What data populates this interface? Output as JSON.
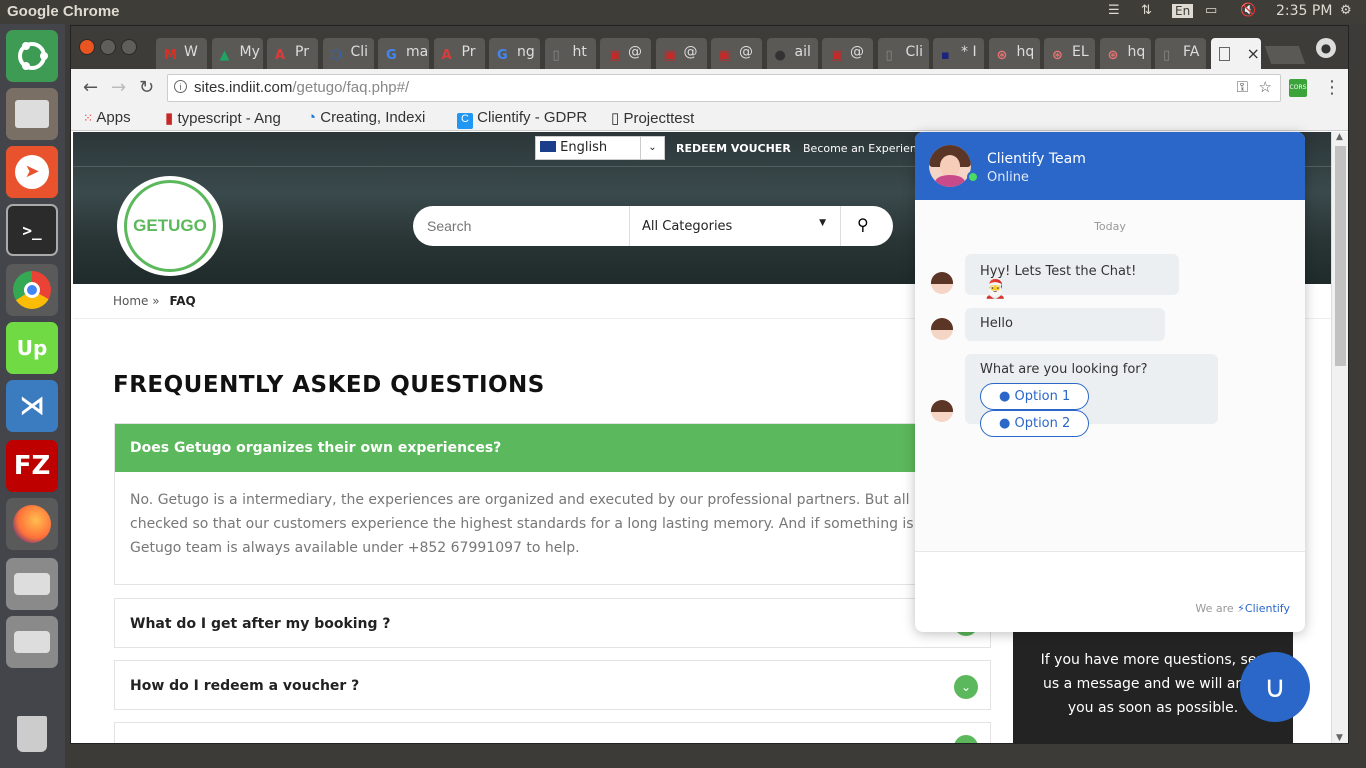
{
  "os": {
    "app_name": "Google Chrome",
    "keyboard_layout": "En",
    "clock": "2:35 PM"
  },
  "launcher": {
    "items": [
      "ubuntu-dash",
      "files",
      "postman",
      "terminal",
      "chrome",
      "upwork",
      "vscode",
      "filezilla",
      "firefox",
      "drive",
      "drive",
      "trash"
    ]
  },
  "browser": {
    "tabs": [
      {
        "title": "W",
        "favicon_color": "#d93025",
        "favicon_glyph": "M"
      },
      {
        "title": "My",
        "favicon_color": "#1fa463",
        "favicon_glyph": "▲"
      },
      {
        "title": "Pr",
        "favicon_color": "#dd3b3b",
        "favicon_glyph": "A"
      },
      {
        "title": "Cli",
        "favicon_color": "#2a67c8",
        "favicon_glyph": "⬡"
      },
      {
        "title": "ma",
        "favicon_color": "#4285f4",
        "favicon_glyph": "G"
      },
      {
        "title": "Pr",
        "favicon_color": "#dd3b3b",
        "favicon_glyph": "A"
      },
      {
        "title": "ng",
        "favicon_color": "#4285f4",
        "favicon_glyph": "G"
      },
      {
        "title": "ht",
        "favicon_color": "#888888",
        "favicon_glyph": "▯"
      },
      {
        "title": "@",
        "favicon_color": "#c62828",
        "favicon_glyph": "▣"
      },
      {
        "title": "@",
        "favicon_color": "#c62828",
        "favicon_glyph": "▣"
      },
      {
        "title": "@",
        "favicon_color": "#c62828",
        "favicon_glyph": "▣"
      },
      {
        "title": "ail",
        "favicon_color": "#333333",
        "favicon_glyph": "●"
      },
      {
        "title": "@",
        "favicon_color": "#c62828",
        "favicon_glyph": "▣"
      },
      {
        "title": "Cli",
        "favicon_color": "#888888",
        "favicon_glyph": "▯"
      },
      {
        "title": "* I",
        "favicon_color": "#1a237e",
        "favicon_glyph": "▪"
      },
      {
        "title": "hq",
        "favicon_color": "#e57373",
        "favicon_glyph": "⊛"
      },
      {
        "title": "EL",
        "favicon_color": "#e57373",
        "favicon_glyph": "⊛"
      },
      {
        "title": "hq",
        "favicon_color": "#e57373",
        "favicon_glyph": "⊛"
      },
      {
        "title": "FA",
        "favicon_color": "#888888",
        "favicon_glyph": "▯"
      }
    ],
    "active_tab_close": "×",
    "url_host": "sites.indiit.com",
    "url_path": "/getugo/faq.php#/",
    "bookmarks": [
      {
        "label": "Apps",
        "icon": "apps-grid"
      },
      {
        "label": "typescript - Ang",
        "icon": "bookmark"
      },
      {
        "label": "Creating, Indexi",
        "icon": "loader"
      },
      {
        "label": "Clientify - GDPR",
        "icon": "clientify"
      },
      {
        "label": "Projecttest",
        "icon": "page"
      }
    ],
    "extension_badge": "CORS"
  },
  "site": {
    "language": "English",
    "redeem_voucher": "REDEEM VOUCHER",
    "become_experience": "Become an Experience",
    "logo_text": "GETUGO",
    "search_placeholder": "Search",
    "category_selected": "All Categories",
    "breadcrumb_home": "Home",
    "breadcrumb_sep": "»",
    "breadcrumb_current": "FAQ",
    "page_title": "FREQUENTLY ASKED QUESTIONS",
    "faq": [
      {
        "q": "Does Getugo organizes their own experiences?",
        "a_lines": [
          "No. Getugo is a intermediary, the experiences are organized and executed by our professional partners. But all partners a",
          "checked so that our customers experience the highest standards for a long lasting memory. And if something is not right,",
          "Getugo team is always available under +852 67991097 to help."
        ],
        "open": true
      },
      {
        "q": "What do I get after my booking ?",
        "open": false
      },
      {
        "q": "How do I redeem a voucher ?",
        "open": false
      }
    ],
    "contact_box_lines": [
      "If you have more questions, sen",
      "us a message and we will answ",
      "you as soon as possible."
    ]
  },
  "chat": {
    "agent_name": "Clientify Team",
    "status": "Online",
    "day_label": "Today",
    "messages": [
      {
        "text": "Hyy! Lets Test the Chat!",
        "emoji": "🎅"
      },
      {
        "text": "Hello"
      },
      {
        "text": "What are you looking for?",
        "options": [
          "Option 1",
          "Option 2"
        ]
      }
    ],
    "footer_prefix": "We are",
    "footer_brand": "Clientify",
    "accent_color": "#2a67c8"
  }
}
